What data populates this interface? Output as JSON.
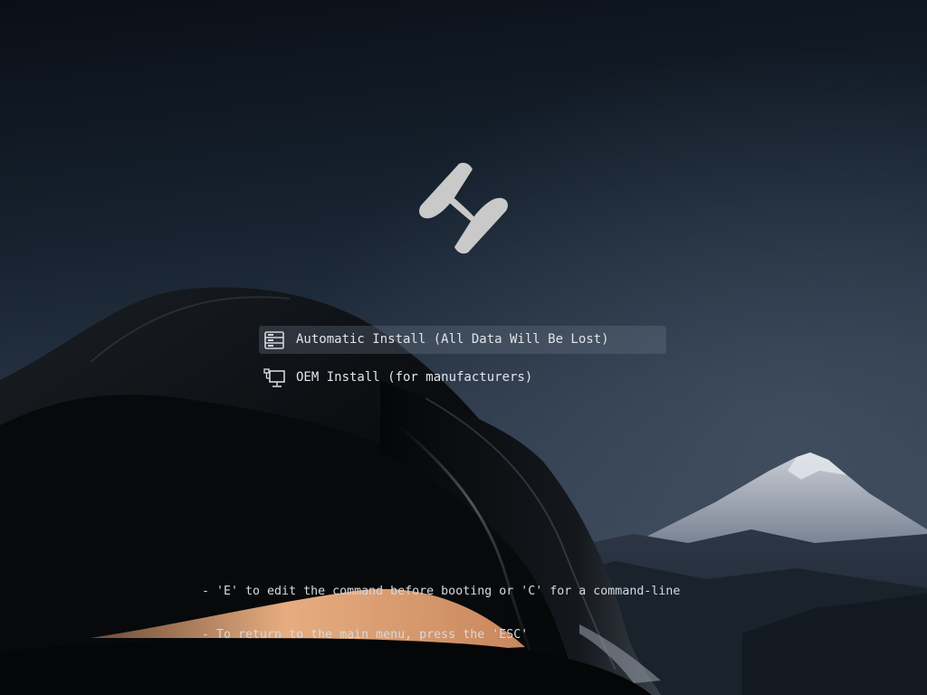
{
  "boot_menu": {
    "entries": [
      {
        "label": "Automatic Install (All Data Will Be Lost)",
        "icon": "drive-icon",
        "selected": true
      },
      {
        "label": "OEM Install (for manufacturers)",
        "icon": "computer-network-icon",
        "selected": false
      }
    ]
  },
  "help": {
    "line1": "- 'E' to edit the command before booting or 'C' for a command-line",
    "line2": "- To return to the main menu, press the 'ESC'"
  },
  "colors": {
    "sky_top": "#0b1118",
    "sky_mid": "#1a2735",
    "sky_low": "#3d4a5c",
    "selection": "#4a5563",
    "accent_sand": "#e3a87a",
    "text": "#e1e4e8"
  },
  "logo_icon": "distro-logo-icon"
}
